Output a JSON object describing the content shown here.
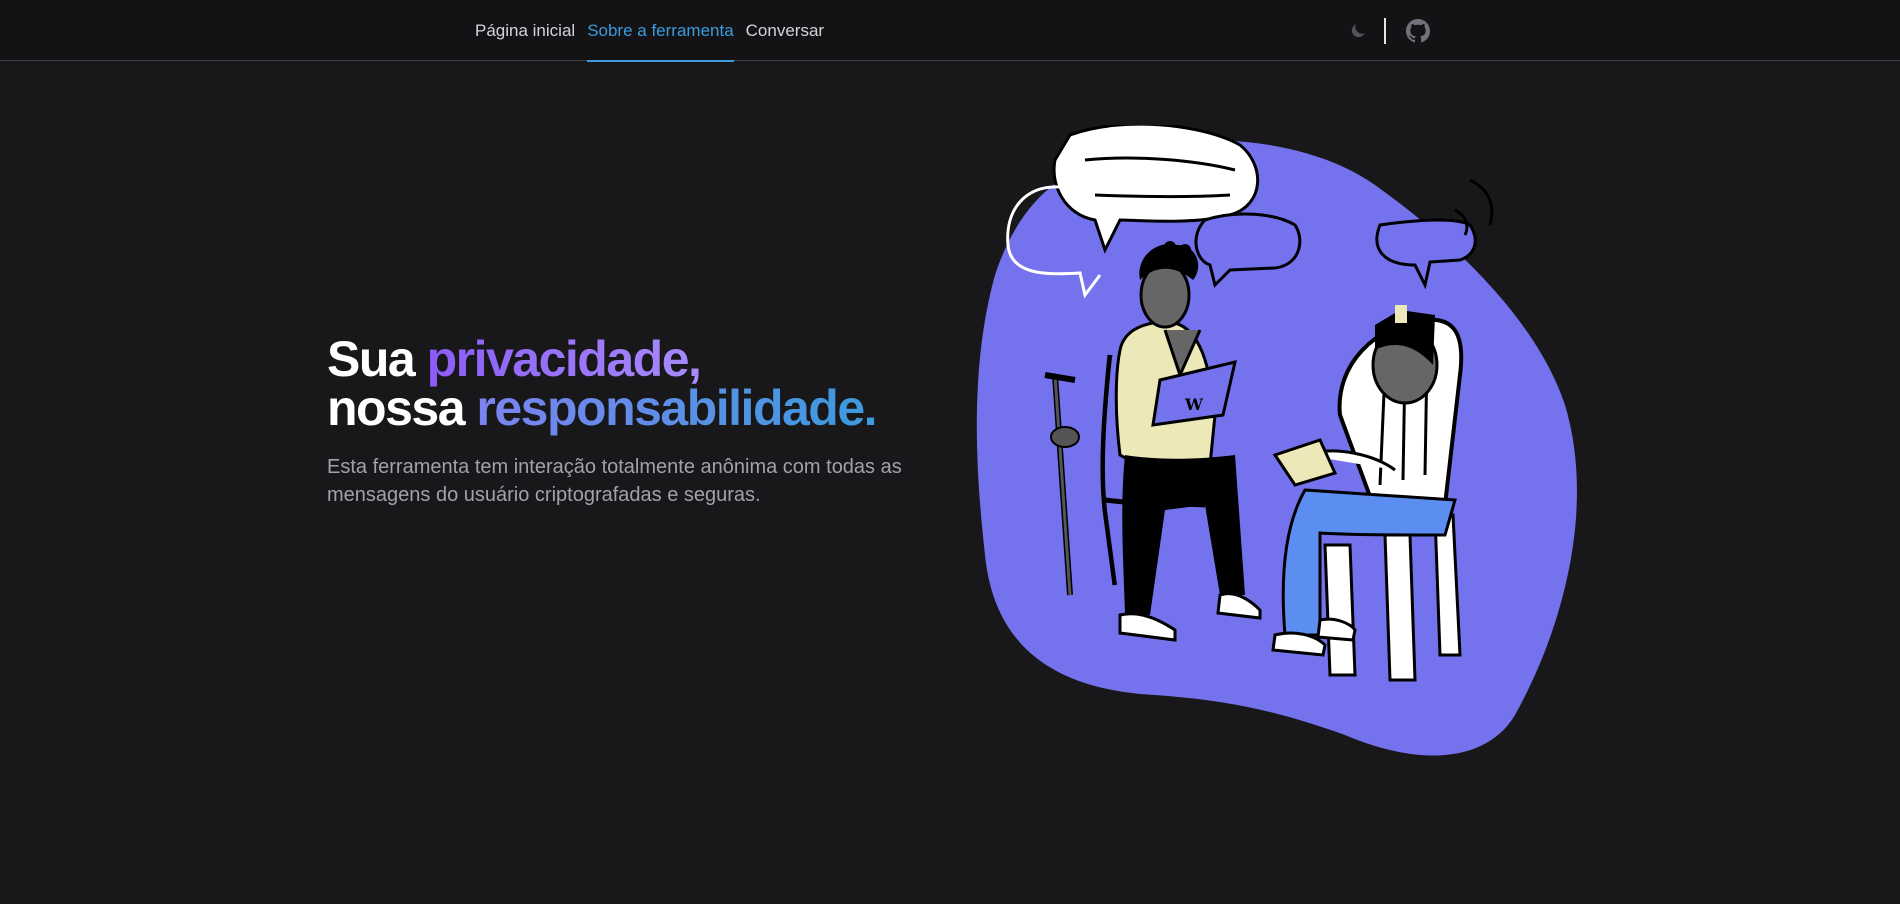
{
  "nav": {
    "items": [
      {
        "label": "Página inicial",
        "active": false
      },
      {
        "label": "Sobre a ferramenta",
        "active": true
      },
      {
        "label": "Conversar",
        "active": false
      }
    ]
  },
  "tools": {
    "theme_icon": "moon-icon",
    "github_icon": "github-icon"
  },
  "hero": {
    "line1_plain": "Sua ",
    "line1_accent": "privacidade,",
    "line2_plain": "nossa ",
    "line2_accent": "responsabilidade.",
    "description": "Esta ferramenta tem interação totalmente anônima com todas as mensagens do usuário criptografadas e seguras."
  },
  "colors": {
    "background": "#18181b",
    "accent_blue": "#3b9bdc",
    "accent_purple": "#8b5cf6",
    "blob": "#7572ee"
  }
}
